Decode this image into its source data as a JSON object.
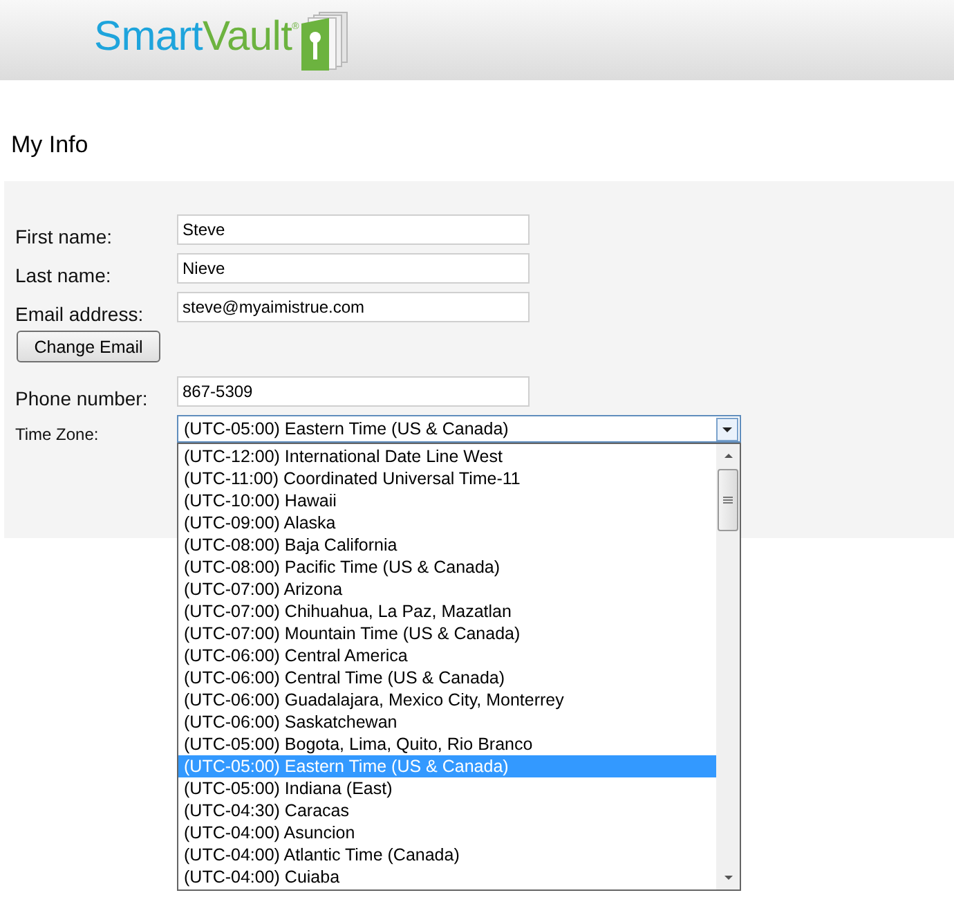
{
  "header": {
    "logo": {
      "brand_part_1": "Smart",
      "brand_part_2": "Vault",
      "registered_mark": "®"
    }
  },
  "page_title": "My Info",
  "form": {
    "rows": [
      {
        "kind": "text",
        "label": "First name:",
        "value": "Steve"
      },
      {
        "kind": "text",
        "label": "Last name:",
        "value": "Nieve"
      },
      {
        "kind": "text",
        "label": "Email address:",
        "value": "steve@myaimistrue.com"
      },
      {
        "kind": "button",
        "label": "Change Email"
      },
      {
        "kind": "text",
        "label": "Phone number:",
        "value": "867-5309"
      },
      {
        "kind": "select",
        "label": "Time Zone:",
        "value": "(UTC-05:00) Eastern Time (US & Canada)",
        "expanded": true,
        "options": [
          {
            "label": "(UTC-12:00) International Date Line West",
            "selected": false
          },
          {
            "label": "(UTC-11:00) Coordinated Universal Time-11",
            "selected": false
          },
          {
            "label": "(UTC-10:00) Hawaii",
            "selected": false
          },
          {
            "label": "(UTC-09:00) Alaska",
            "selected": false
          },
          {
            "label": "(UTC-08:00) Baja California",
            "selected": false
          },
          {
            "label": "(UTC-08:00) Pacific Time (US & Canada)",
            "selected": false
          },
          {
            "label": "(UTC-07:00) Arizona",
            "selected": false
          },
          {
            "label": "(UTC-07:00) Chihuahua, La Paz, Mazatlan",
            "selected": false
          },
          {
            "label": "(UTC-07:00) Mountain Time (US & Canada)",
            "selected": false
          },
          {
            "label": "(UTC-06:00) Central America",
            "selected": false
          },
          {
            "label": "(UTC-06:00) Central Time (US & Canada)",
            "selected": false
          },
          {
            "label": "(UTC-06:00) Guadalajara, Mexico City, Monterrey",
            "selected": false
          },
          {
            "label": "(UTC-06:00) Saskatchewan",
            "selected": false
          },
          {
            "label": "(UTC-05:00) Bogota, Lima, Quito, Rio Branco",
            "selected": false
          },
          {
            "label": "(UTC-05:00) Eastern Time (US & Canada)",
            "selected": true
          },
          {
            "label": "(UTC-05:00) Indiana (East)",
            "selected": false
          },
          {
            "label": "(UTC-04:30) Caracas",
            "selected": false
          },
          {
            "label": "(UTC-04:00) Asuncion",
            "selected": false
          },
          {
            "label": "(UTC-04:00) Atlantic Time (Canada)",
            "selected": false
          },
          {
            "label": "(UTC-04:00) Cuiaba",
            "selected": false
          }
        ]
      }
    ]
  }
}
